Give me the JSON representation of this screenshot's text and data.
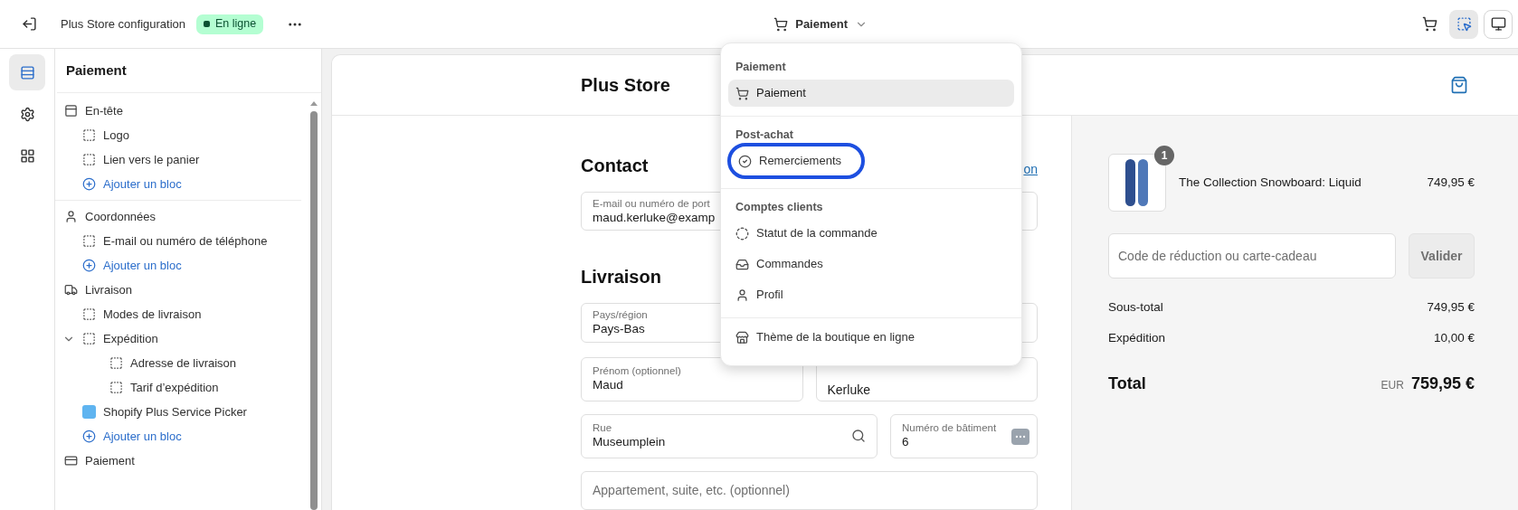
{
  "topbar": {
    "store_name": "Plus Store configuration",
    "status_badge": "En ligne",
    "page_selector": "Paiement",
    "right_buttons": [
      {
        "selected": false
      },
      {
        "selected": true
      },
      {
        "selected": false
      }
    ]
  },
  "rail": [
    {
      "selected": true
    },
    {
      "selected": false
    },
    {
      "selected": false
    }
  ],
  "sidebar": {
    "title": "Paiement",
    "sections": [
      {
        "label": "En-tête",
        "children": [
          {
            "kind": "block",
            "label": "Logo"
          },
          {
            "kind": "block",
            "label": "Lien vers le panier"
          },
          {
            "kind": "add",
            "label": "Ajouter un bloc"
          }
        ]
      },
      {
        "label": "Coordonnées",
        "children": [
          {
            "kind": "block",
            "label": "E-mail ou numéro de téléphone"
          },
          {
            "kind": "add",
            "label": "Ajouter un bloc"
          }
        ]
      },
      {
        "label": "Livraison",
        "children": [
          {
            "kind": "block",
            "label": "Modes de livraison"
          },
          {
            "kind": "block",
            "label": "Expédition",
            "expanded": true,
            "children": [
              {
                "kind": "block",
                "label": "Adresse de livraison"
              },
              {
                "kind": "block",
                "label": "Tarif d’expédition"
              }
            ]
          },
          {
            "kind": "app",
            "label": "Shopify Plus Service Picker"
          },
          {
            "kind": "add",
            "label": "Ajouter un bloc"
          }
        ]
      },
      {
        "label": "Paiement"
      }
    ]
  },
  "dropdown": {
    "groups": [
      {
        "title": "Paiement",
        "items": [
          {
            "label": "Paiement",
            "selected": true,
            "highlighted": false
          }
        ]
      },
      {
        "title": "Post-achat",
        "items": [
          {
            "label": "Remerciements",
            "selected": false,
            "highlighted": true
          }
        ]
      },
      {
        "title": "Comptes clients",
        "items": [
          {
            "label": "Statut de la commande",
            "selected": false,
            "highlighted": false
          },
          {
            "label": "Commandes",
            "selected": false,
            "highlighted": false
          },
          {
            "label": "Profil",
            "selected": false,
            "highlighted": false
          }
        ]
      },
      {
        "items": [
          {
            "label": "Thème de la boutique en ligne",
            "selected": false,
            "highlighted": false
          }
        ]
      }
    ]
  },
  "preview": {
    "store_title": "Plus Store",
    "contact": {
      "heading": "Contact",
      "link": "on",
      "field": {
        "label": "E-mail ou numéro de port",
        "value": "maud.kerluke@examp"
      }
    },
    "delivery": {
      "heading": "Livraison",
      "country": {
        "label": "Pays/région",
        "value": "Pays-Bas"
      },
      "first_name": {
        "label": "Prénom (optionnel)",
        "value": "Maud"
      },
      "last_name": {
        "value": "Kerluke"
      },
      "street": {
        "label": "Rue",
        "value": "Museumplein"
      },
      "building": {
        "label": "Numéro de bâtiment",
        "value": "6"
      },
      "apartment": {
        "placeholder": "Appartement, suite, etc. (optionnel)"
      }
    },
    "summary": {
      "product": {
        "quantity": "1",
        "name": "The Collection Snowboard: Liquid",
        "price": "749,95 €"
      },
      "discount": {
        "placeholder": "Code de réduction ou carte-cadeau",
        "button": "Valider"
      },
      "lines": [
        {
          "label": "Sous-total",
          "value": "749,95 €"
        },
        {
          "label": "Expédition",
          "value": "10,00 €"
        }
      ],
      "total": {
        "label": "Total",
        "currency": "EUR",
        "amount": "759,95 €"
      }
    }
  }
}
